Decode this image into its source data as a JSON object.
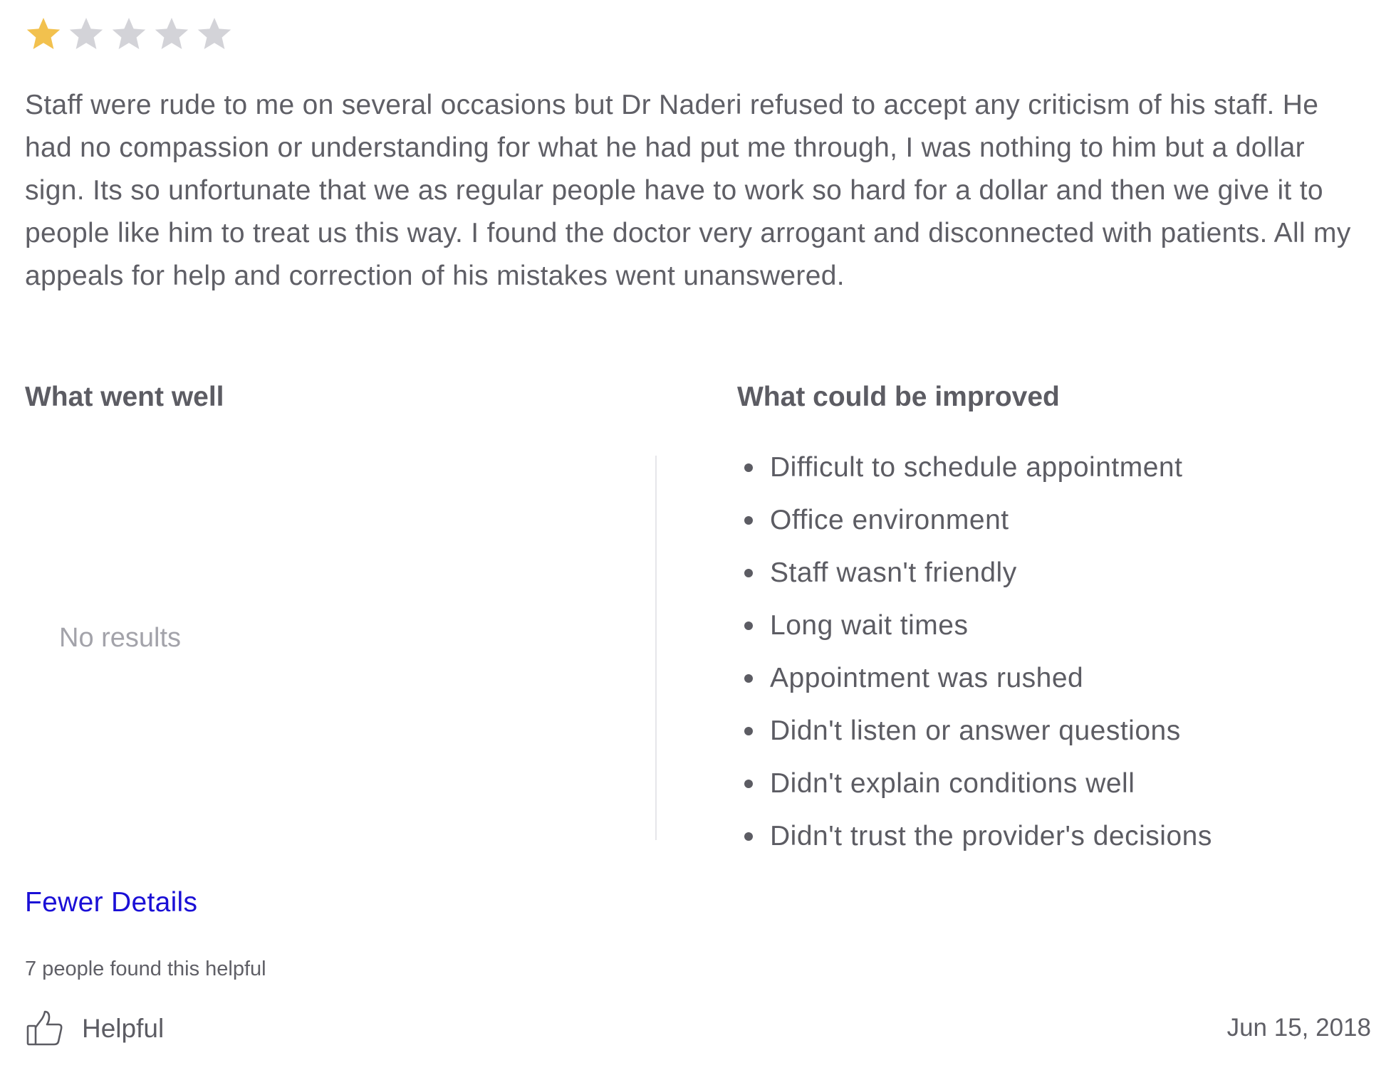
{
  "rating": {
    "value": 1,
    "max": 5,
    "filled_color": "#f2c14e",
    "empty_color": "#d3d3d8",
    "icon": "star-icon"
  },
  "review_text": "Staff were rude to me on several occasions but Dr Naderi refused to accept any criticism of his staff. He had no compassion or understanding for what he had put me through, I was nothing to him but a dollar sign. Its so unfortunate that we as regular people have to work so hard for a dollar and then we give it to people like him to treat us this way. I found the doctor very arrogant and disconnected with patients. All my appeals for help and correction of his mistakes went unanswered.",
  "went_well": {
    "heading": "What went well",
    "empty_text": "No results"
  },
  "improved": {
    "heading": "What could be improved",
    "items": [
      "Difficult to schedule appointment",
      "Office environment",
      "Staff wasn't friendly",
      "Long wait times",
      "Appointment was rushed",
      "Didn't listen or answer questions",
      "Didn't explain conditions well",
      "Didn't trust the provider's decisions"
    ]
  },
  "fewer_details_label": "Fewer Details",
  "link_color": "#1a0fd6",
  "helpful_count_text": "7 people found this helpful",
  "helpful_button": {
    "label": "Helpful",
    "icon": "thumbs-up-icon"
  },
  "date": "Jun 15, 2018"
}
